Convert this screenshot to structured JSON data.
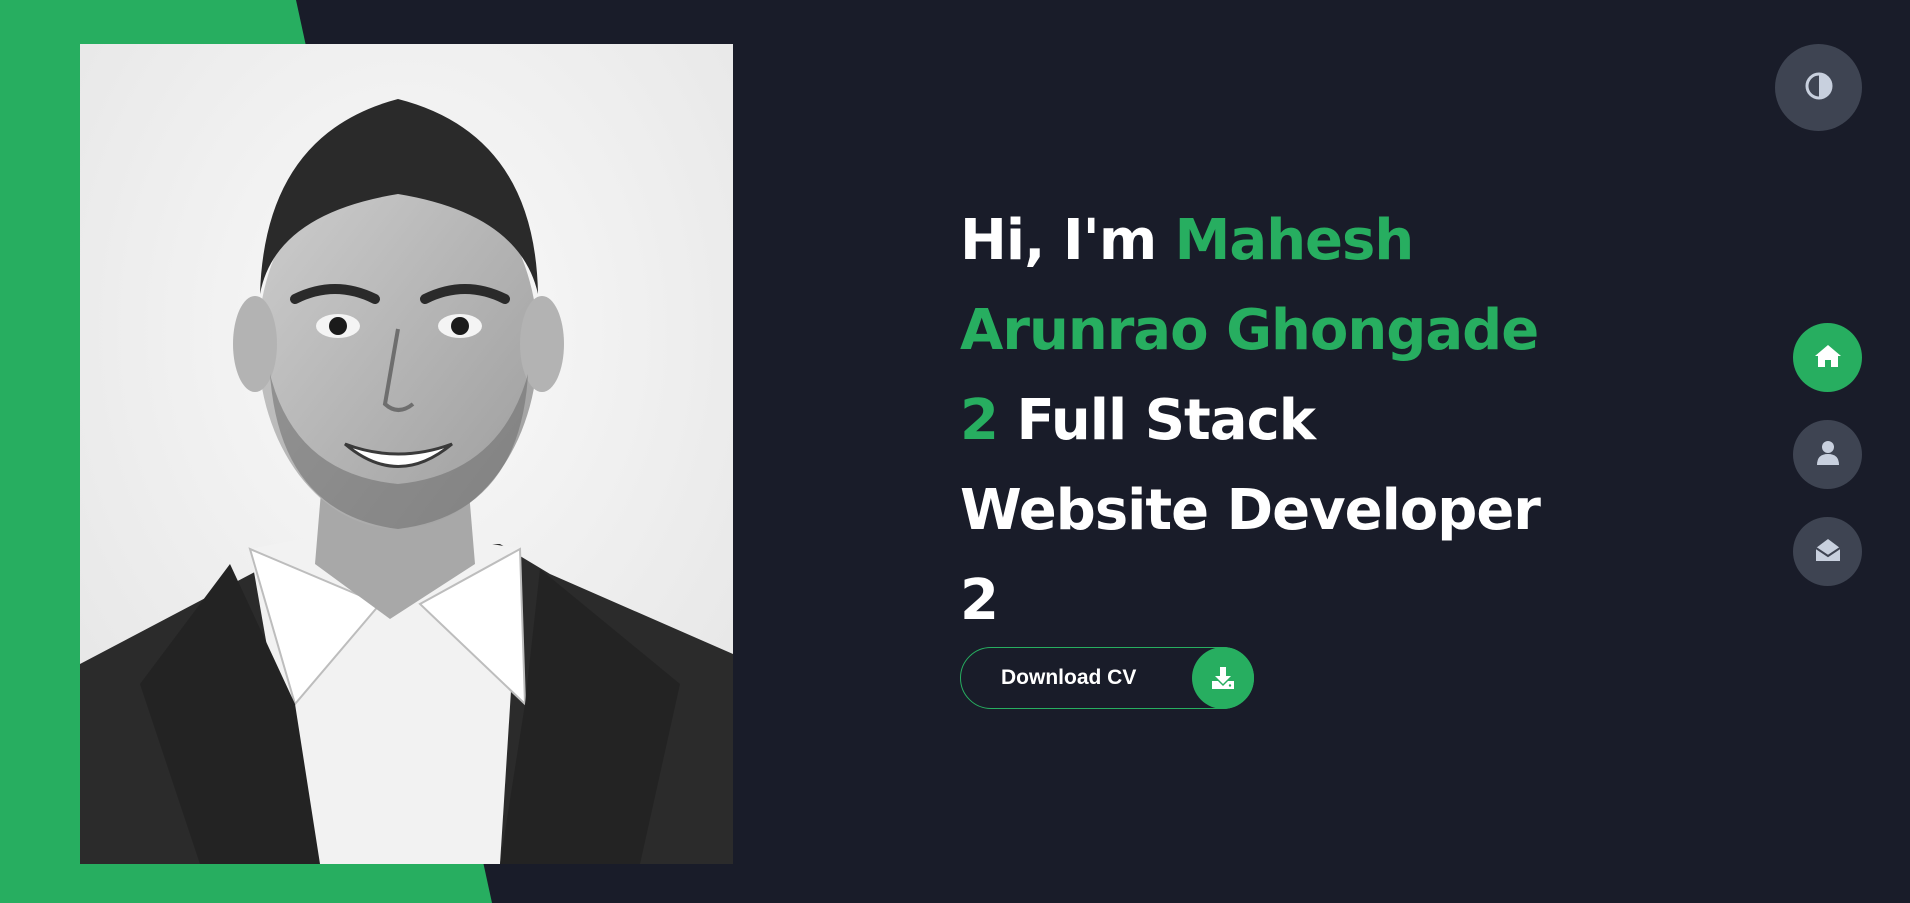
{
  "hero": {
    "greeting": "Hi, I'm",
    "name_part1": "Mahesh",
    "name_part2": "Arunrao Ghongade",
    "counter_1": "2",
    "role_line1": "Full Stack",
    "role_line2": "Website Developer",
    "counter_2": "2"
  },
  "cta": {
    "download_label": "Download CV",
    "icon": "download-icon"
  },
  "controls": {
    "theme_icon": "contrast-icon"
  },
  "nav": {
    "items": [
      {
        "icon": "home-icon",
        "active": true
      },
      {
        "icon": "user-icon",
        "active": false
      },
      {
        "icon": "envelope-open-icon",
        "active": false
      }
    ]
  },
  "colors": {
    "accent": "#27ae60",
    "background": "#191c29",
    "button_muted": "#3e4452",
    "icon_muted": "#c8d0de"
  }
}
